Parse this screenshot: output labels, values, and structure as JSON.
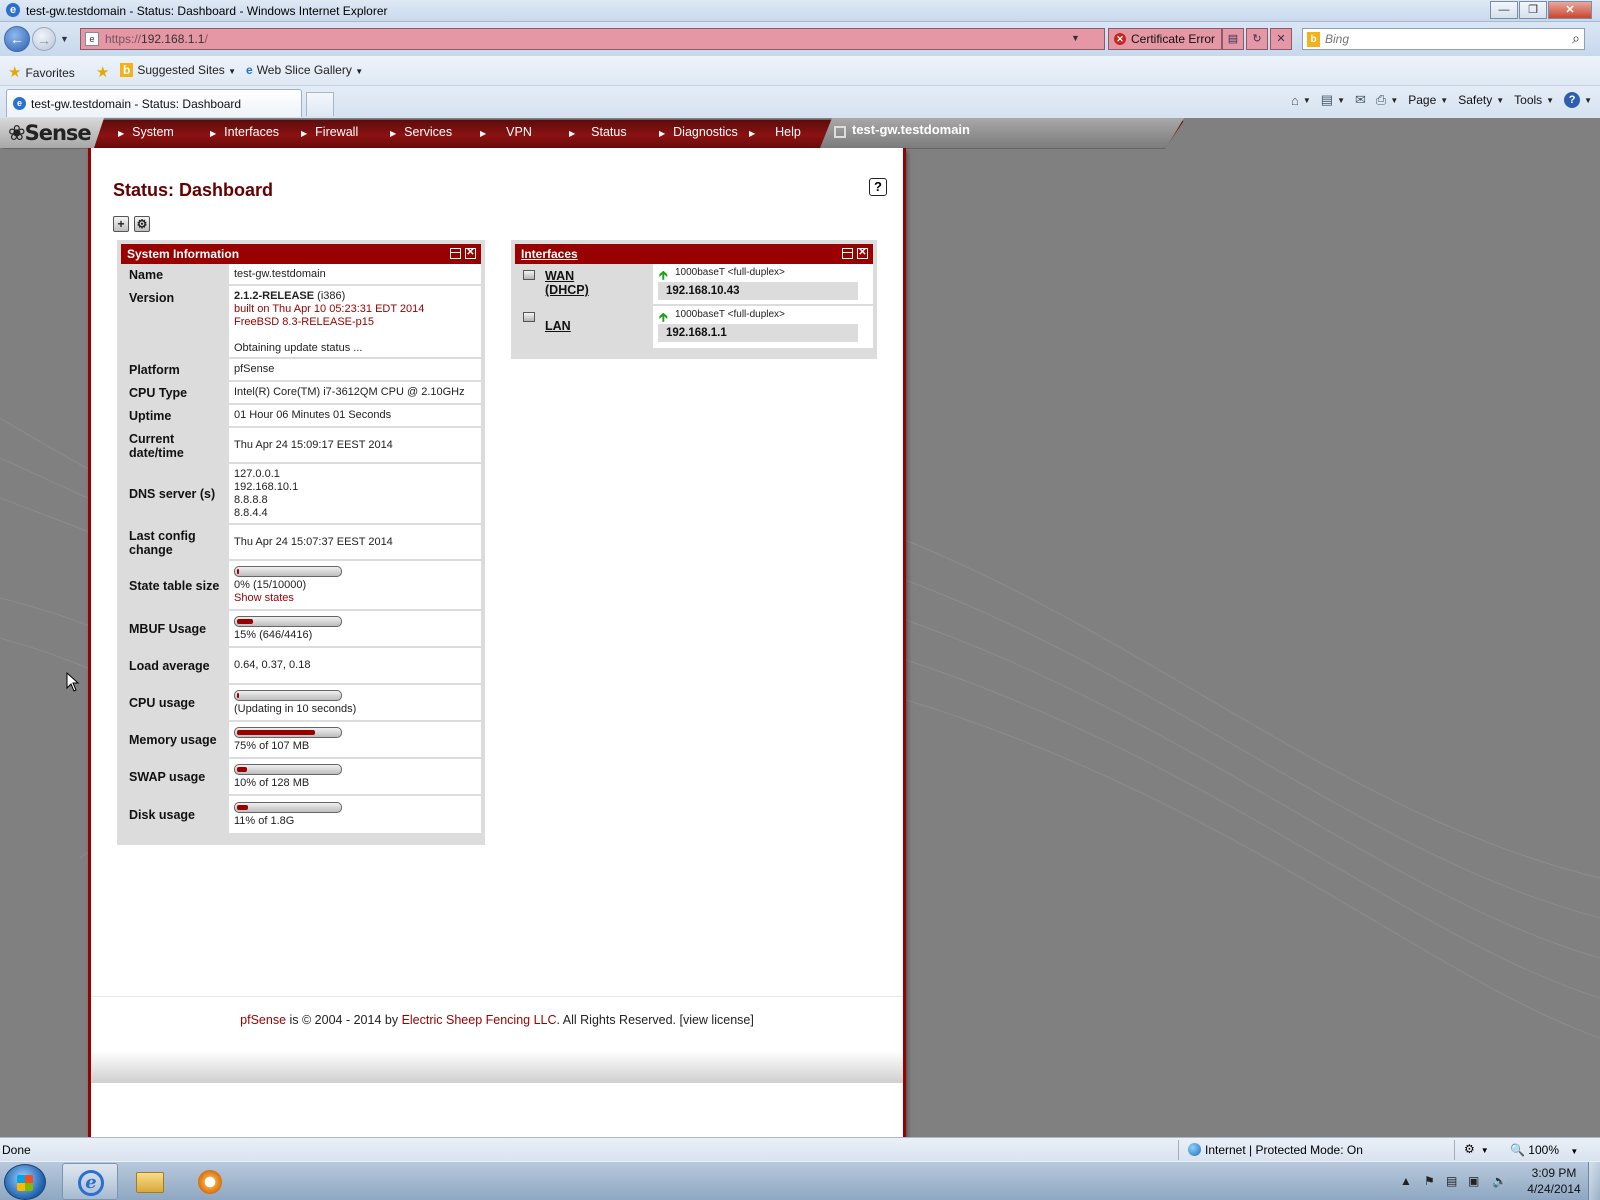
{
  "window": {
    "title": "test-gw.testdomain - Status: Dashboard - Windows Internet Explorer"
  },
  "address": {
    "protocol": "https://",
    "host": "192.168.1.1",
    "path": "/",
    "cert_error": "Certificate Error",
    "search_placeholder": "Bing"
  },
  "favorites": {
    "favorites_label": "Favorites",
    "suggested_sites": "Suggested Sites",
    "web_slice_gallery": "Web Slice Gallery"
  },
  "tab": {
    "label": "test-gw.testdomain - Status: Dashboard"
  },
  "command_bar": {
    "page": "Page",
    "safety": "Safety",
    "tools": "Tools"
  },
  "pfsense": {
    "logo": "Sense",
    "menu": [
      "System",
      "Interfaces",
      "Firewall",
      "Services",
      "VPN",
      "Status",
      "Diagnostics",
      "Help"
    ],
    "hostname": "test-gw.testdomain",
    "page_title": "Status: Dashboard",
    "help_symbol": "?"
  },
  "system_info": {
    "title": "System Information",
    "rows": {
      "name": {
        "label": "Name",
        "value": "test-gw.testdomain"
      },
      "version": {
        "label": "Version",
        "release": "2.1.2-RELEASE",
        "arch": " (i386)",
        "built": "built on Thu Apr 10 05:23:31 EDT 2014",
        "freebsd": "FreeBSD 8.3-RELEASE-p15",
        "update": "Obtaining update status ..."
      },
      "platform": {
        "label": "Platform",
        "value": "pfSense"
      },
      "cpu_type": {
        "label": "CPU Type",
        "value": "Intel(R) Core(TM) i7-3612QM CPU @ 2.10GHz"
      },
      "uptime": {
        "label": "Uptime",
        "value": "01 Hour 06 Minutes 01 Seconds"
      },
      "datetime": {
        "label": "Current date/time",
        "value": "Thu Apr 24 15:09:17 EEST 2014"
      },
      "dns": {
        "label": "DNS server (s)",
        "servers": [
          "127.0.0.1",
          "192.168.10.1",
          "8.8.8.8",
          "8.8.4.4"
        ]
      },
      "last_config": {
        "label": "Last config change",
        "value": "Thu Apr 24 15:07:37 EEST 2014"
      },
      "state_table": {
        "label": "State table size",
        "value": "0% (15/10000)",
        "link": "Show states",
        "percent": 0
      },
      "mbuf": {
        "label": "MBUF Usage",
        "value": "15% (646/4416)",
        "percent": 15
      },
      "load": {
        "label": "Load average",
        "value": "0.64, 0.37, 0.18"
      },
      "cpu_usage": {
        "label": "CPU usage",
        "value": "(Updating in 10 seconds)",
        "percent": 0
      },
      "memory": {
        "label": "Memory usage",
        "value": "75% of 107 MB",
        "percent": 75
      },
      "swap": {
        "label": "SWAP usage",
        "value": "10% of 128 MB",
        "percent": 10
      },
      "disk": {
        "label": "Disk usage",
        "value": "11% of 1.8G",
        "percent": 11
      }
    }
  },
  "interfaces": {
    "title": "Interfaces",
    "items": [
      {
        "name": "WAN",
        "sub": "(DHCP)",
        "media": "1000baseT <full-duplex>",
        "ip": "192.168.10.43"
      },
      {
        "name": "LAN",
        "sub": "",
        "media": "1000baseT <full-duplex>",
        "ip": "192.168.1.1"
      }
    ]
  },
  "footer": {
    "brand": "pfSense",
    "text": " is © 2004 - 2014 by ",
    "company": "Electric Sheep Fencing LLC",
    "rights": ". All Rights Reserved. ",
    "license": "[view license]"
  },
  "statusbar": {
    "status": "Done",
    "zone": "Internet | Protected Mode: On",
    "zoom": "100%"
  },
  "taskbar": {
    "time": "3:09 PM",
    "date": "4/24/2014"
  },
  "colors": {
    "pfsense_red": "#990000",
    "title_red": "#660000",
    "address_error": "#e597a6"
  }
}
